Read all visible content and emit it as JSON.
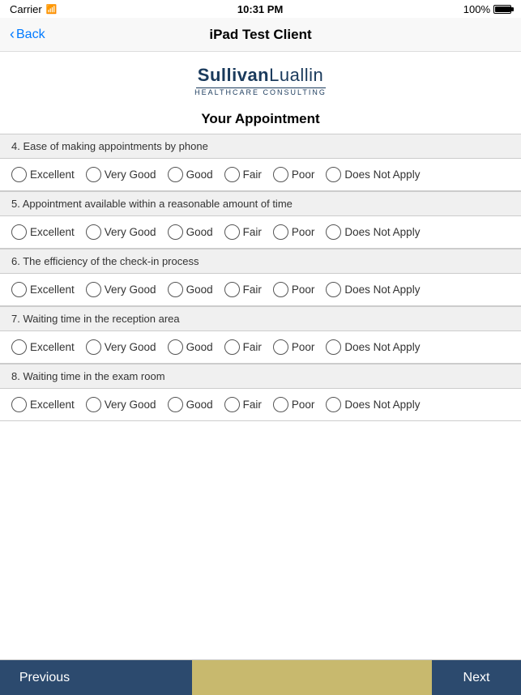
{
  "statusBar": {
    "carrier": "Carrier",
    "time": "10:31 PM",
    "battery": "100%"
  },
  "navBar": {
    "backLabel": "Back",
    "title": "iPad Test Client"
  },
  "logo": {
    "namePart1": "Sullivan",
    "namePart2": "Luallin",
    "subtitle": "HEALTHCARE CONSULTING"
  },
  "pageTitle": "Your Appointment",
  "questions": [
    {
      "id": "q4",
      "label": "4. Ease of making appointments by phone",
      "options": [
        "Excellent",
        "Very Good",
        "Good",
        "Fair",
        "Poor",
        "Does Not Apply"
      ]
    },
    {
      "id": "q5",
      "label": "5. Appointment available within a reasonable amount of time",
      "options": [
        "Excellent",
        "Very Good",
        "Good",
        "Fair",
        "Poor",
        "Does Not Apply"
      ]
    },
    {
      "id": "q6",
      "label": "6. The efficiency of the check-in process",
      "options": [
        "Excellent",
        "Very Good",
        "Good",
        "Fair",
        "Poor",
        "Does Not Apply"
      ]
    },
    {
      "id": "q7",
      "label": "7. Waiting time in the reception area",
      "options": [
        "Excellent",
        "Very Good",
        "Good",
        "Fair",
        "Poor",
        "Does Not Apply"
      ]
    },
    {
      "id": "q8",
      "label": "8. Waiting time in the exam room",
      "options": [
        "Excellent",
        "Very Good",
        "Good",
        "Fair",
        "Poor",
        "Does Not Apply"
      ]
    }
  ],
  "footer": {
    "previousLabel": "Previous",
    "nextLabel": "Next",
    "progressPercent": 30
  }
}
